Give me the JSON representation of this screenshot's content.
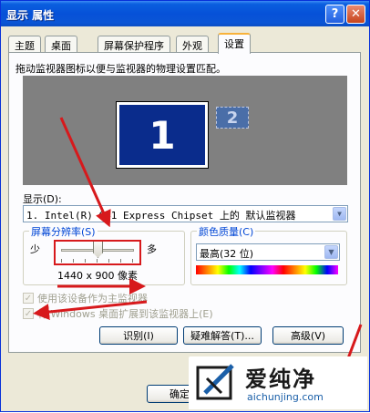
{
  "window": {
    "title": "显示 属性"
  },
  "titlebar": {
    "help_glyph": "?",
    "close_glyph": "✕"
  },
  "tabs": [
    {
      "label": "主题"
    },
    {
      "label": "桌面"
    },
    {
      "label": "屏幕保护程序"
    },
    {
      "label": "外观"
    },
    {
      "label": "设置"
    }
  ],
  "settings": {
    "instruction": "拖动监视器图标以便与监视器的物理设置匹配。",
    "monitor1": "1",
    "monitor2": "2",
    "display_label": "显示(D):",
    "display_value": "1. Intel(R) G41 Express Chipset 上的 默认监视器",
    "resolution": {
      "group_label": "屏幕分辨率(S)",
      "less": "少",
      "more": "多",
      "value": "1440 x 900 像素",
      "slider_fraction": 0.5
    },
    "color": {
      "group_label": "颜色质量(C)",
      "value": "最高(32 位)"
    },
    "primary_checkbox": "使用该设备作为主监视器",
    "extend_checkbox": "将 Windows 桌面扩展到该监视器上(E)",
    "buttons": {
      "identify": "识别(I)",
      "troubleshoot": "疑难解答(T)...",
      "advanced": "高级(V)",
      "ok": "确定"
    }
  },
  "watermark": {
    "name": "爱纯净",
    "url": "aichunjing.com"
  },
  "colors": {
    "annotation_red": "#d7191c",
    "title_blue": "#0651d8",
    "group_label_blue": "#0046d5"
  }
}
